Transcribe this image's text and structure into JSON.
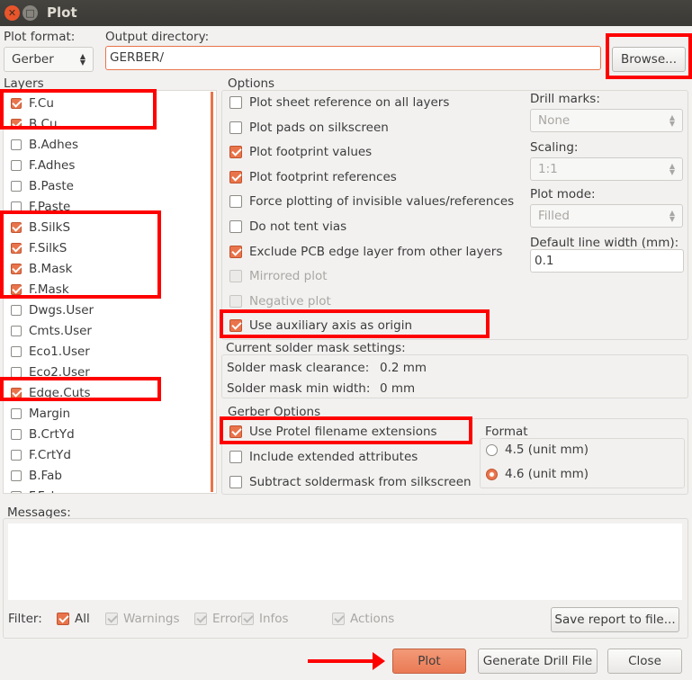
{
  "window": {
    "title": "Plot"
  },
  "plot_format": {
    "label": "Plot format:",
    "value": "Gerber"
  },
  "output_dir": {
    "label": "Output directory:",
    "value": "GERBER/",
    "browse": "Browse..."
  },
  "layers": {
    "title": "Layers",
    "items": [
      {
        "name": "F.Cu",
        "checked": true
      },
      {
        "name": "B.Cu",
        "checked": true
      },
      {
        "name": "B.Adhes",
        "checked": false
      },
      {
        "name": "F.Adhes",
        "checked": false
      },
      {
        "name": "B.Paste",
        "checked": false
      },
      {
        "name": "F.Paste",
        "checked": false
      },
      {
        "name": "B.SilkS",
        "checked": true
      },
      {
        "name": "F.SilkS",
        "checked": true
      },
      {
        "name": "B.Mask",
        "checked": true
      },
      {
        "name": "F.Mask",
        "checked": true
      },
      {
        "name": "Dwgs.User",
        "checked": false
      },
      {
        "name": "Cmts.User",
        "checked": false
      },
      {
        "name": "Eco1.User",
        "checked": false
      },
      {
        "name": "Eco2.User",
        "checked": false
      },
      {
        "name": "Edge.Cuts",
        "checked": true
      },
      {
        "name": "Margin",
        "checked": false
      },
      {
        "name": "B.CrtYd",
        "checked": false
      },
      {
        "name": "F.CrtYd",
        "checked": false
      },
      {
        "name": "B.Fab",
        "checked": false
      },
      {
        "name": "F.Fab",
        "checked": false
      }
    ]
  },
  "options": {
    "title": "Options",
    "items": [
      {
        "label": "Plot sheet reference on all layers",
        "checked": false,
        "disabled": false
      },
      {
        "label": "Plot pads on silkscreen",
        "checked": false,
        "disabled": false
      },
      {
        "label": "Plot footprint values",
        "checked": true,
        "disabled": false
      },
      {
        "label": "Plot footprint references",
        "checked": true,
        "disabled": false
      },
      {
        "label": "Force plotting of invisible values/references",
        "checked": false,
        "disabled": false
      },
      {
        "label": "Do not tent vias",
        "checked": false,
        "disabled": false
      },
      {
        "label": "Exclude PCB edge layer from other layers",
        "checked": true,
        "disabled": false
      },
      {
        "label": "Mirrored plot",
        "checked": false,
        "disabled": true
      },
      {
        "label": "Negative plot",
        "checked": false,
        "disabled": true
      },
      {
        "label": "Use auxiliary axis as origin",
        "checked": true,
        "disabled": false
      }
    ],
    "drill_marks": {
      "label": "Drill marks:",
      "value": "None"
    },
    "scaling": {
      "label": "Scaling:",
      "value": "1:1"
    },
    "plot_mode": {
      "label": "Plot mode:",
      "value": "Filled"
    },
    "line_width": {
      "label": "Default line width (mm):",
      "value": "0.1"
    }
  },
  "solder_mask": {
    "title": "Current solder mask settings:",
    "clearance_label": "Solder mask clearance:",
    "clearance": "0.2 mm",
    "min_width_label": "Solder mask min width:",
    "min_width": "0 mm"
  },
  "gerber": {
    "title": "Gerber Options",
    "items": [
      {
        "label": "Use Protel filename extensions",
        "checked": true
      },
      {
        "label": "Include extended attributes",
        "checked": false
      },
      {
        "label": "Subtract soldermask from silkscreen",
        "checked": false
      }
    ],
    "format": {
      "title": "Format",
      "options": [
        {
          "label": "4.5 (unit mm)",
          "selected": false
        },
        {
          "label": "4.6 (unit mm)",
          "selected": true
        }
      ]
    }
  },
  "messages": {
    "title": "Messages:",
    "filter_label": "Filter:",
    "filters": [
      {
        "label": "All",
        "checked": true,
        "disabled": false
      },
      {
        "label": "Warnings",
        "checked": true,
        "disabled": true
      },
      {
        "label": "Errors",
        "checked": true,
        "disabled": true
      },
      {
        "label": "Infos",
        "checked": true,
        "disabled": true
      },
      {
        "label": "Actions",
        "checked": true,
        "disabled": true
      }
    ],
    "save_report": "Save report to file..."
  },
  "buttons": {
    "plot": "Plot",
    "drill": "Generate Drill File",
    "close": "Close"
  },
  "colors": {
    "accent": "#e9744b",
    "highlight": "#ff0000"
  }
}
